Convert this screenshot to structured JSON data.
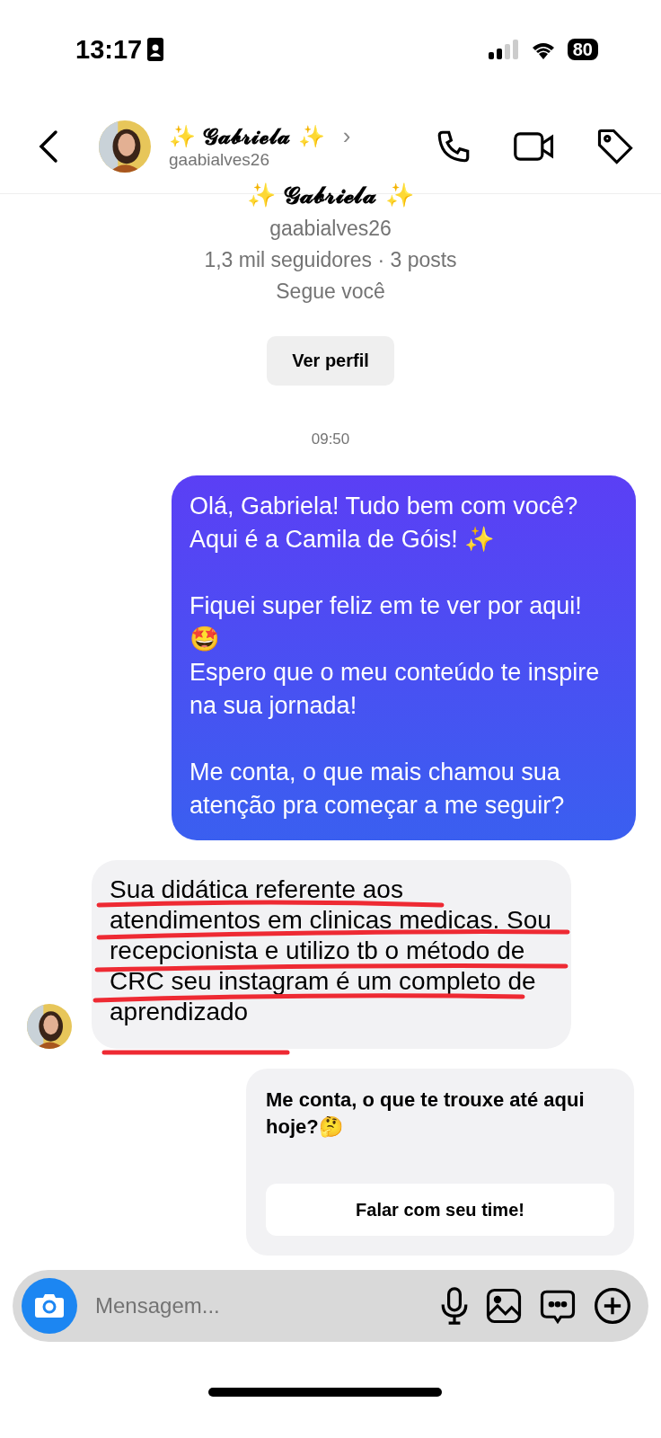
{
  "status_bar": {
    "time": "13:17",
    "battery": "80"
  },
  "header": {
    "name": "✨ 𝓖𝓪𝓫𝓻𝓲𝓮𝓵𝓪 ✨",
    "chevron": "›",
    "username": "gaabialves26"
  },
  "profile": {
    "name": "✨ 𝓖𝓪𝓫𝓻𝓲𝓮𝓵𝓪 ✨",
    "username": "gaabialves26",
    "stats": "1,3 mil seguidores · 3 posts",
    "follows": "Segue você",
    "button": "Ver perfil"
  },
  "messages": [
    {
      "kind": "time",
      "text": "09:50"
    },
    {
      "kind": "outgoing",
      "text": "Olá, Gabriela! Tudo bem com você?\nAqui é a Camila de Góis! ✨\n\nFiquei super feliz em te ver por aqui!\n🤩\nEspero que o meu conteúdo te inspire na sua jornada!\n\nMe conta, o que mais chamou sua atenção pra começar a me seguir?"
    },
    {
      "kind": "incoming",
      "text": "Sua didática referente aos atendimentos em clinicas medicas. Sou recepcionista e utilizo tb o método de CRC seu instagram é um completo de aprendizado"
    },
    {
      "kind": "prompt",
      "text": "Me conta, o que te trouxe até aqui hoje?🤔",
      "button": "Falar com seu time!"
    }
  ],
  "composer": {
    "placeholder": "Mensagem..."
  }
}
